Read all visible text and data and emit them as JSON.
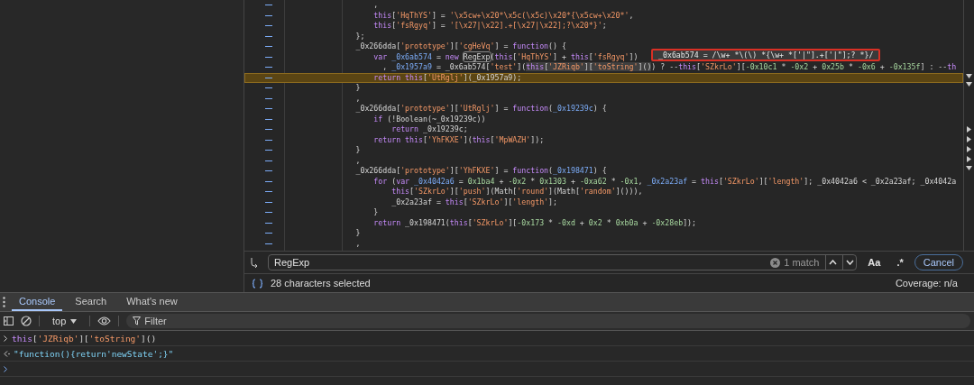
{
  "editor": {
    "lines": [
      {
        "highlighted": false,
        "tokens": [
          {
            "kind": "plain",
            "text": "                    ,"
          }
        ]
      },
      {
        "highlighted": false,
        "tokens": [
          {
            "kind": "keyword",
            "text": "                    this"
          },
          {
            "kind": "plain",
            "text": "["
          },
          {
            "kind": "string",
            "text": "'HqThYS'"
          },
          {
            "kind": "plain",
            "text": "] = "
          },
          {
            "kind": "string",
            "text": "'\\x5cw+\\x20*\\x5c(\\x5c)\\x20*{\\x5cw+\\x20*'"
          },
          {
            "kind": "plain",
            "text": ","
          }
        ]
      },
      {
        "highlighted": false,
        "tokens": [
          {
            "kind": "keyword",
            "text": "                    this"
          },
          {
            "kind": "plain",
            "text": "["
          },
          {
            "kind": "string",
            "text": "'fsRgyq'"
          },
          {
            "kind": "plain",
            "text": "] = "
          },
          {
            "kind": "string",
            "text": "'[\\x27|\\x22].+[\\x27|\\x22];?\\x20*}'"
          },
          {
            "kind": "plain",
            "text": ";"
          }
        ]
      },
      {
        "highlighted": false,
        "tokens": [
          {
            "kind": "plain",
            "text": "                };"
          }
        ]
      },
      {
        "highlighted": false,
        "tokens": [
          {
            "kind": "plain",
            "text": "                _0x266dda["
          },
          {
            "kind": "string",
            "text": "'prototype'"
          },
          {
            "kind": "plain",
            "text": "]["
          },
          {
            "kind": "string",
            "text": "'cgHeVq'"
          },
          {
            "kind": "plain",
            "text": "] = "
          },
          {
            "kind": "keyword",
            "text": "function"
          },
          {
            "kind": "plain",
            "text": "() {"
          }
        ]
      },
      {
        "highlighted": false,
        "tokens": [
          {
            "kind": "keyword",
            "text": "                    var "
          },
          {
            "kind": "variable",
            "text": "_0x6ab574"
          },
          {
            "kind": "plain",
            "text": " = "
          },
          {
            "kind": "keyword",
            "text": "new "
          },
          {
            "kind": "match",
            "text": "RegExp"
          },
          {
            "kind": "plain",
            "text": "("
          },
          {
            "kind": "keyword",
            "text": "this"
          },
          {
            "kind": "plain",
            "text": "["
          },
          {
            "kind": "string",
            "text": "'HqThYS'"
          },
          {
            "kind": "plain",
            "text": "] + "
          },
          {
            "kind": "keyword",
            "text": "this"
          },
          {
            "kind": "plain",
            "text": "["
          },
          {
            "kind": "string",
            "text": "'fsRgyq'"
          },
          {
            "kind": "plain",
            "text": "])"
          }
        ]
      },
      {
        "highlighted": false,
        "tokens": [
          {
            "kind": "plain",
            "text": "                      , "
          },
          {
            "kind": "variable",
            "text": "_0x1957a9"
          },
          {
            "kind": "plain",
            "text": " = _0x6ab574["
          },
          {
            "kind": "string",
            "text": "'test'"
          },
          {
            "kind": "plain",
            "text": "]("
          },
          {
            "kind": "keyword-selected",
            "text": "this"
          },
          {
            "kind": "plain-selected",
            "text": "["
          },
          {
            "kind": "string-selected",
            "text": "'JZRiqb'"
          },
          {
            "kind": "plain-selected",
            "text": "]["
          },
          {
            "kind": "string-selected",
            "text": "'toString'"
          },
          {
            "kind": "plain-selected",
            "text": "]()"
          },
          {
            "kind": "plain",
            "text": ") ? --"
          },
          {
            "kind": "keyword",
            "text": "this"
          },
          {
            "kind": "plain",
            "text": "["
          },
          {
            "kind": "string",
            "text": "'SZkrLo'"
          },
          {
            "kind": "plain",
            "text": "]["
          },
          {
            "kind": "number",
            "text": "-0x10c1"
          },
          {
            "kind": "plain",
            "text": " * "
          },
          {
            "kind": "number",
            "text": "-0x2"
          },
          {
            "kind": "plain",
            "text": " + "
          },
          {
            "kind": "number",
            "text": "0x25b"
          },
          {
            "kind": "plain",
            "text": " * "
          },
          {
            "kind": "number",
            "text": "-0x6"
          },
          {
            "kind": "plain",
            "text": " + "
          },
          {
            "kind": "number",
            "text": "-0x135f"
          },
          {
            "kind": "plain",
            "text": "] : --"
          },
          {
            "kind": "keyword",
            "text": "th"
          }
        ]
      },
      {
        "highlighted": true,
        "tokens": [
          {
            "kind": "keyword",
            "text": "                    return this"
          },
          {
            "kind": "plain",
            "text": "["
          },
          {
            "kind": "string",
            "text": "'UtRglj'"
          },
          {
            "kind": "plain",
            "text": "](_0x1957a9);"
          }
        ]
      },
      {
        "highlighted": false,
        "tokens": [
          {
            "kind": "plain",
            "text": "                }"
          }
        ]
      },
      {
        "highlighted": false,
        "tokens": [
          {
            "kind": "plain",
            "text": "                ,"
          }
        ]
      },
      {
        "highlighted": false,
        "tokens": [
          {
            "kind": "plain",
            "text": "                _0x266dda["
          },
          {
            "kind": "string",
            "text": "'prototype'"
          },
          {
            "kind": "plain",
            "text": "]["
          },
          {
            "kind": "string",
            "text": "'UtRglj'"
          },
          {
            "kind": "plain",
            "text": "] = "
          },
          {
            "kind": "keyword",
            "text": "function"
          },
          {
            "kind": "plain",
            "text": "("
          },
          {
            "kind": "variable",
            "text": "_0x19239c"
          },
          {
            "kind": "plain",
            "text": ") {"
          }
        ]
      },
      {
        "highlighted": false,
        "tokens": [
          {
            "kind": "keyword",
            "text": "                    if"
          },
          {
            "kind": "plain",
            "text": " (!Boolean(~_0x19239c))"
          }
        ]
      },
      {
        "highlighted": false,
        "tokens": [
          {
            "kind": "keyword",
            "text": "                        return"
          },
          {
            "kind": "plain",
            "text": " _0x19239c;"
          }
        ]
      },
      {
        "highlighted": false,
        "tokens": [
          {
            "kind": "keyword",
            "text": "                    return this"
          },
          {
            "kind": "plain",
            "text": "["
          },
          {
            "kind": "string",
            "text": "'YhFKXE'"
          },
          {
            "kind": "plain",
            "text": "]("
          },
          {
            "kind": "keyword",
            "text": "this"
          },
          {
            "kind": "plain",
            "text": "["
          },
          {
            "kind": "string",
            "text": "'MpWAZH'"
          },
          {
            "kind": "plain",
            "text": "]);"
          }
        ]
      },
      {
        "highlighted": false,
        "tokens": [
          {
            "kind": "plain",
            "text": "                }"
          }
        ]
      },
      {
        "highlighted": false,
        "tokens": [
          {
            "kind": "plain",
            "text": "                ,"
          }
        ]
      },
      {
        "highlighted": false,
        "tokens": [
          {
            "kind": "plain",
            "text": "                _0x266dda["
          },
          {
            "kind": "string",
            "text": "'prototype'"
          },
          {
            "kind": "plain",
            "text": "]["
          },
          {
            "kind": "string",
            "text": "'YhFKXE'"
          },
          {
            "kind": "plain",
            "text": "] = "
          },
          {
            "kind": "keyword",
            "text": "function"
          },
          {
            "kind": "plain",
            "text": "("
          },
          {
            "kind": "variable",
            "text": "_0x198471"
          },
          {
            "kind": "plain",
            "text": ") {"
          }
        ]
      },
      {
        "highlighted": false,
        "tokens": [
          {
            "kind": "keyword",
            "text": "                    for"
          },
          {
            "kind": "plain",
            "text": " ("
          },
          {
            "kind": "keyword",
            "text": "var "
          },
          {
            "kind": "variable",
            "text": "_0x4042a6"
          },
          {
            "kind": "plain",
            "text": " = "
          },
          {
            "kind": "number",
            "text": "0x1ba4"
          },
          {
            "kind": "plain",
            "text": " + "
          },
          {
            "kind": "number",
            "text": "-0x2"
          },
          {
            "kind": "plain",
            "text": " * "
          },
          {
            "kind": "number",
            "text": "0x1303"
          },
          {
            "kind": "plain",
            "text": " + "
          },
          {
            "kind": "number",
            "text": "-0xa62"
          },
          {
            "kind": "plain",
            "text": " * "
          },
          {
            "kind": "number",
            "text": "-0x1"
          },
          {
            "kind": "plain",
            "text": ", "
          },
          {
            "kind": "variable",
            "text": "_0x2a23af"
          },
          {
            "kind": "plain",
            "text": " = "
          },
          {
            "kind": "keyword",
            "text": "this"
          },
          {
            "kind": "plain",
            "text": "["
          },
          {
            "kind": "string",
            "text": "'SZkrLo'"
          },
          {
            "kind": "plain",
            "text": "]["
          },
          {
            "kind": "string",
            "text": "'length'"
          },
          {
            "kind": "plain",
            "text": "]; _0x4042a6 < _0x2a23af; _0x4042a"
          }
        ]
      },
      {
        "highlighted": false,
        "tokens": [
          {
            "kind": "keyword",
            "text": "                        this"
          },
          {
            "kind": "plain",
            "text": "["
          },
          {
            "kind": "string",
            "text": "'SZkrLo'"
          },
          {
            "kind": "plain",
            "text": "]["
          },
          {
            "kind": "string",
            "text": "'push'"
          },
          {
            "kind": "plain",
            "text": "](Math["
          },
          {
            "kind": "string",
            "text": "'round'"
          },
          {
            "kind": "plain",
            "text": "](Math["
          },
          {
            "kind": "string",
            "text": "'random'"
          },
          {
            "kind": "plain",
            "text": "]())),"
          }
        ]
      },
      {
        "highlighted": false,
        "tokens": [
          {
            "kind": "plain",
            "text": "                        _0x2a23af = "
          },
          {
            "kind": "keyword",
            "text": "this"
          },
          {
            "kind": "plain",
            "text": "["
          },
          {
            "kind": "string",
            "text": "'SZkrLo'"
          },
          {
            "kind": "plain",
            "text": "]["
          },
          {
            "kind": "string",
            "text": "'length'"
          },
          {
            "kind": "plain",
            "text": "];"
          }
        ]
      },
      {
        "highlighted": false,
        "tokens": [
          {
            "kind": "plain",
            "text": "                    }"
          }
        ]
      },
      {
        "highlighted": false,
        "tokens": [
          {
            "kind": "keyword",
            "text": "                    return"
          },
          {
            "kind": "plain",
            "text": " _0x198471("
          },
          {
            "kind": "keyword",
            "text": "this"
          },
          {
            "kind": "plain",
            "text": "["
          },
          {
            "kind": "string",
            "text": "'SZkrLo'"
          },
          {
            "kind": "plain",
            "text": "]["
          },
          {
            "kind": "number",
            "text": "-0x173"
          },
          {
            "kind": "plain",
            "text": " * "
          },
          {
            "kind": "number",
            "text": "-0xd"
          },
          {
            "kind": "plain",
            "text": " + "
          },
          {
            "kind": "number",
            "text": "0x2"
          },
          {
            "kind": "plain",
            "text": " * "
          },
          {
            "kind": "number",
            "text": "0xb0a"
          },
          {
            "kind": "plain",
            "text": " + "
          },
          {
            "kind": "number",
            "text": "-0x28eb"
          },
          {
            "kind": "plain",
            "text": "]);"
          }
        ]
      },
      {
        "highlighted": false,
        "tokens": [
          {
            "kind": "plain",
            "text": "                }"
          }
        ]
      },
      {
        "highlighted": false,
        "tokens": [
          {
            "kind": "plain",
            "text": "                ,"
          }
        ]
      }
    ],
    "hover_tooltip": "_0x6ab574 = /\\w+ *\\(\\) *{\\w+ *['|\"].+['|\"];? *}/"
  },
  "find_bar": {
    "value": "RegExp",
    "match_count": "1 match",
    "case_toggle": "Aa",
    "regex_toggle": ".*",
    "cancel": "Cancel"
  },
  "status_bar": {
    "selection": "28 characters selected",
    "coverage": "Coverage: n/a"
  },
  "drawer": {
    "tabs": [
      {
        "label": "Console",
        "selected": true
      },
      {
        "label": "Search",
        "selected": false
      },
      {
        "label": "What's new",
        "selected": false
      }
    ],
    "context": "top",
    "filter": {
      "placeholder": "Filter"
    },
    "entries": [
      {
        "kind": "input",
        "tokens": [
          {
            "kind": "keyword",
            "text": "this"
          },
          {
            "kind": "plain",
            "text": "["
          },
          {
            "kind": "string",
            "text": "'JZRiqb'"
          },
          {
            "kind": "plain",
            "text": "]["
          },
          {
            "kind": "string",
            "text": "'toString'"
          },
          {
            "kind": "plain",
            "text": "]()"
          }
        ]
      },
      {
        "kind": "output",
        "tokens": [
          {
            "kind": "result",
            "text": "\"function(){return'newState';}\""
          }
        ]
      }
    ]
  }
}
